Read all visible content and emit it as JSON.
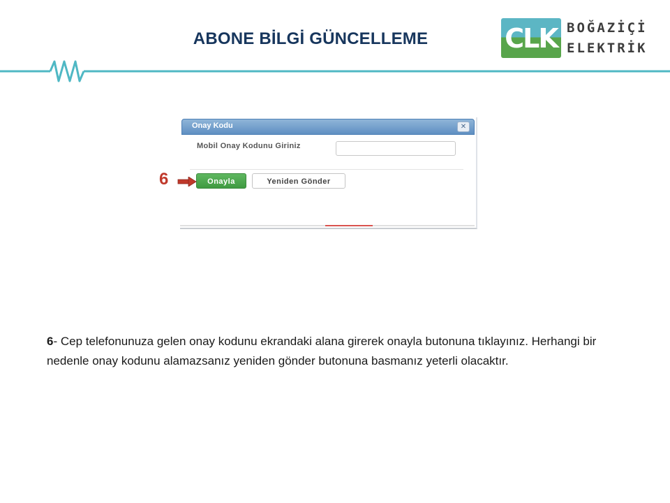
{
  "slide": {
    "title": "ABONE BİLGİ GÜNCELLEME"
  },
  "logo": {
    "mark_text": "CLK",
    "line1": "BOĞAZİÇİ",
    "line2": "ELEKTRİK",
    "colors": {
      "teal": "#5cb6c4",
      "green": "#58a54b",
      "text": "#3d3d3d"
    }
  },
  "dialog": {
    "title": "Onay Kodu",
    "close_icon": "close-icon",
    "field_label": "Mobil Onay Kodunu Giriniz",
    "code_input": {
      "value": "",
      "placeholder": ""
    },
    "approve_label": "Onayla",
    "resend_label": "Yeniden Gönder"
  },
  "annotation": {
    "step_number": "6",
    "arrow_icon": "right-arrow-icon",
    "color": "#c0392b"
  },
  "instruction": {
    "step_prefix": "6",
    "text": "- Cep telefonunuza gelen onay kodunu ekrandaki alana girerek onayla butonuna tıklayınız. Herhangi bir nedenle onay kodunu alamazsanız yeniden gönder butonuna basmanız yeterli olacaktır."
  },
  "theme": {
    "title_color": "#17365d",
    "divider_color": "#4fb8c4",
    "approve_green": "#3f9a41"
  }
}
